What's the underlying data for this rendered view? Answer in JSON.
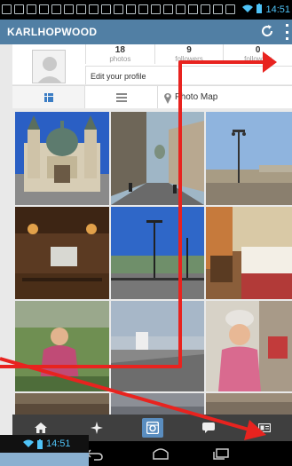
{
  "status_bar": {
    "time": "14:51"
  },
  "app_bar": {
    "username": "KARLHOPWOOD",
    "refresh_icon": "refresh-icon",
    "overflow_icon": "overflow-menu-icon"
  },
  "profile": {
    "stats": [
      {
        "value": "18",
        "label": "photos"
      },
      {
        "value": "9",
        "label": "followers"
      },
      {
        "value": "0",
        "label": "following"
      }
    ],
    "edit_label": "Edit your profile"
  },
  "view_toggles": {
    "map_label": "Photo Map"
  },
  "photos": [
    {
      "subject": "basilica"
    },
    {
      "subject": "street"
    },
    {
      "subject": "riverside-lamps"
    },
    {
      "subject": "interior-hall"
    },
    {
      "subject": "lamp-posts"
    },
    {
      "subject": "hotel-room"
    },
    {
      "subject": "child-grass"
    },
    {
      "subject": "harbour-sky"
    },
    {
      "subject": "child-kitchen"
    },
    {
      "subject": "partial-1"
    },
    {
      "subject": "partial-2"
    },
    {
      "subject": "partial-3"
    }
  ],
  "bottom_nav": [
    {
      "icon": "home-icon"
    },
    {
      "icon": "explore-star-icon"
    },
    {
      "icon": "camera-icon"
    },
    {
      "icon": "activity-bubble-icon"
    },
    {
      "icon": "profile-card-icon"
    }
  ],
  "overlay_status": {
    "time": "14:51"
  },
  "colors": {
    "app_bar": "#517fa4",
    "accent": "#3b7dc4",
    "annotation": "#e8231f",
    "nav_bg": "#3f3f3f"
  }
}
